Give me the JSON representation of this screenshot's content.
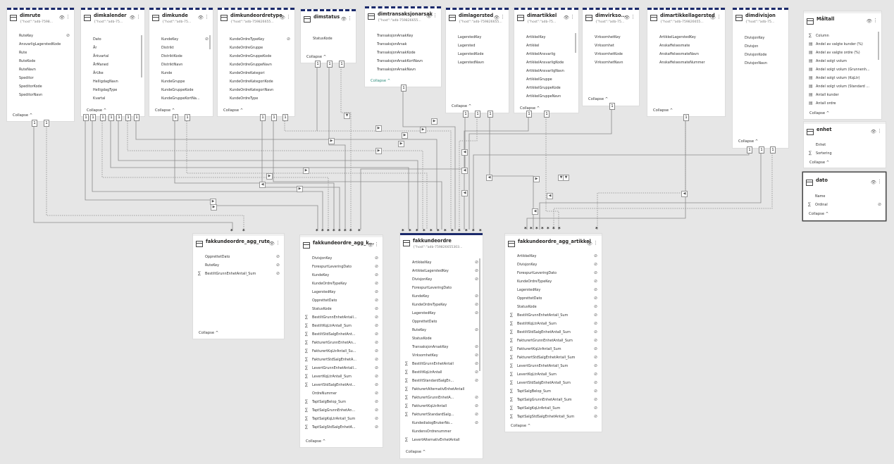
{
  "tables": [
    {
      "name": "dimrute",
      "subtitle": "{\"host\":\"adb-7598...",
      "fields": [
        "RuteKey",
        "AnsvarligLagerstedKode",
        "Rute",
        "RuteKode",
        "RuteNavn",
        "Speditor",
        "SpeditorKode",
        "SpeditorNavn"
      ],
      "collapse": "Collapse"
    },
    {
      "name": "dimkalender",
      "subtitle": "{\"host\":\"adb-75...",
      "fields": [
        "Dato",
        "År",
        "Årkvartal",
        "ÅrManed",
        "ÅrUke",
        "HelligdagNavn",
        "HelligdagType",
        "Kvartal"
      ],
      "collapse": "Collapse"
    },
    {
      "name": "dimkunde",
      "subtitle": "{\"host\":\"adb-75...",
      "fields": [
        "KundeKey",
        "Distrikt",
        "DistriktKode",
        "DistriktNavn",
        "Kunde",
        "KundeGruppe",
        "KundeGruppeKode",
        "KundeGruppeKortNa..."
      ],
      "collapse": "Collapse"
    },
    {
      "name": "dimkundeordretype",
      "subtitle": "{\"host\":\"adb-759826655...",
      "fields": [
        "KundeOrdreTypeKey",
        "KundeOrdreGruppe",
        "KundeOrdreGruppeKode",
        "KundeOrdreGruppeNavn",
        "KundeOrdreKategori",
        "KundeOrdreKategoriKode",
        "KundeOrdreKategoriNavn",
        "KundeOrdreType"
      ],
      "collapse": "Collapse"
    },
    {
      "name": "dimstatus",
      "subtitle": "",
      "fields": [
        "StatusKode"
      ],
      "collapse": "Collapse"
    },
    {
      "name": "dimtransaksjonarsak",
      "subtitle": "{\"host\":\"adb-759826655...",
      "fields": [
        "TransaksjonArsakKey",
        "TransaksjonArsak",
        "TransaksjonArsakKode",
        "TransaksjonArsakKortNavn",
        "TransaksjonArsakNavn"
      ],
      "collapse": "Collapse"
    },
    {
      "name": "dimlagersted",
      "subtitle": "{\"host\":\"adb-759826655...",
      "fields": [
        "LagerstedKey",
        "Lagersted",
        "LagerstedKode",
        "LagerstedNavn"
      ],
      "collapse": "Collapse"
    },
    {
      "name": "dimartikkel",
      "subtitle": "{\"host\":\"adb-75...",
      "fields": [
        "ArtikkelKey",
        "Artikkel",
        "ArtikkelAnsvarlig",
        "ArtikkelAnsvarligKode",
        "ArtikkelAnsvarligNavn",
        "ArtikkelGruppe",
        "ArtikkelGruppeKode",
        "ArtikkelGruppeNavn"
      ],
      "collapse": "Collapse"
    },
    {
      "name": "dimvirkso...",
      "subtitle": "{\"host\":\"adb-75...",
      "fields": [
        "VirksomhetKey",
        "Virksomhet",
        "VirksomhetKode",
        "VirksomhetNavn"
      ],
      "collapse": "Collapse"
    },
    {
      "name": "dimartikkellagersted",
      "subtitle": "{\"host\":\"adb-759826655...",
      "fields": [
        "ArtikkelLagerstedKey",
        "Anskaffelsesmate",
        "AnskaffelsesmateNavn",
        "AnskaffelsesmateNummer"
      ],
      "collapse": "Collapse"
    },
    {
      "name": "dimdivisjon",
      "subtitle": "{\"host\":\"adb-75...",
      "fields": [
        "DivisjonKey",
        "Divisjon",
        "DivisjonKode",
        "DivisjonNavn"
      ],
      "collapse": "Collapse"
    },
    {
      "name": "Måltall",
      "subtitle": "",
      "fields": [
        "Column",
        "Andel av valgte kunder (%)",
        "Andel av valgte ordre (%)",
        "Andel solgt volum",
        "Andel solgt volum (Grunnenh...",
        "Andel solgt volum (KqLtr)",
        "Andel solgt volum (Standard ...",
        "Antall kunder",
        "Antall ordre"
      ],
      "collapse": "Collapse"
    },
    {
      "name": "enhet",
      "subtitle": "",
      "fields": [
        "Enhet",
        "Sortering"
      ],
      "collapse": "Collapse"
    },
    {
      "name": "dato",
      "subtitle": "",
      "fields": [
        "Name",
        "Ordinal"
      ],
      "collapse": "Collapse"
    },
    {
      "name": "fakkundeordre_agg_rute",
      "subtitle": "",
      "fields": [
        "OpprettetDato",
        "RuteKey",
        "BestiltGrunnEnhetAntall_Sum"
      ],
      "collapse": "Collapse"
    },
    {
      "name": "fakkundeordre_agg_k...",
      "subtitle": "",
      "fields": [
        "DivisjonKey",
        "ForespurtLeveringDato",
        "KundeKey",
        "KundeOrdreTypeKey",
        "LagerstedKey",
        "OpprettetDato",
        "StatusKode",
        "BestiltGrunnEnhetAntall...",
        "BestiltKqLtrAntall_Sum",
        "BestiltStdSalgEnhetAnt...",
        "FakturertGrunnEnhetAn...",
        "FakturertKqLtrAntall_Su...",
        "FakturertStdSalgEnhetA...",
        "LevertGrunnEnhetAntall...",
        "LevertKqLtrAntall_Sum",
        "LevertStdSalgEnhetAnt...",
        "OrdreNummer",
        "TaptSalgBelop_Sum",
        "TaptSalgGrunnEnhetAn...",
        "TaptSalgKqLtrAntall_Sum",
        "TaptSalgStdSalgEnhetA..."
      ],
      "collapse": "Collapse"
    },
    {
      "name": "fakkundeordre",
      "subtitle": "{\"host\":\"adb-759826655303...",
      "fields": [
        "ArtikkelKey",
        "ArtikkelLagerstedKey",
        "DivisjonKey",
        "ForespurtLeveringDato",
        "KundeKey",
        "KundeOrdreTypeKey",
        "LagerstedKey",
        "OpprettetDato",
        "RuteKey",
        "StatusKode",
        "TransaksjonArsakKey",
        "VirksomhetKey",
        "BestiltGrunnEnhetAntall",
        "BestiltKqLtrAntall",
        "BestiltStandardSalgEn...",
        "FakturertAlternativEnhetAntall",
        "FakturertGrunnEnhetA...",
        "FakturertKqLtrAntall",
        "FakturertStandardSalg...",
        "KundedialogBrukerNo...",
        "KundensOrdrenummer",
        "LevertAlternativEnhetAntall"
      ],
      "collapse": "Collapse"
    },
    {
      "name": "fakkundeordre_agg_artikkel",
      "subtitle": "",
      "fields": [
        "ArtikkelKey",
        "DivisjonKey",
        "ForespurtLeveringDato",
        "KundeOrdreTypeKey",
        "LagerstedKey",
        "OpprettetDato",
        "StatusKode",
        "BestiltGrunnEnhetAntall_Sum",
        "BestiltKqLtrAntall_Sum",
        "BestiltStdSalgEnhetAntall_Sum",
        "FakturertGrunnEnhetAntall_Sum",
        "FakturertKqLtrAntall_Sum",
        "FakturertStdSalgEnhetAntall_Sum",
        "LevertGrunnEnhetAntall_Sum",
        "LevertKqLtrAntall_Sum",
        "LevertStdSalgEnhetAntall_Sum",
        "TaptSalgBelop_Sum",
        "TaptSalgGrunnEnhetAntall_Sum",
        "TaptSalgKqLtrAntall_Sum",
        "TaptSalgStdSalgEnhetAntall_Sum"
      ],
      "collapse": "Collapse"
    }
  ],
  "cardinality": {
    "one": "1",
    "many": "*"
  }
}
